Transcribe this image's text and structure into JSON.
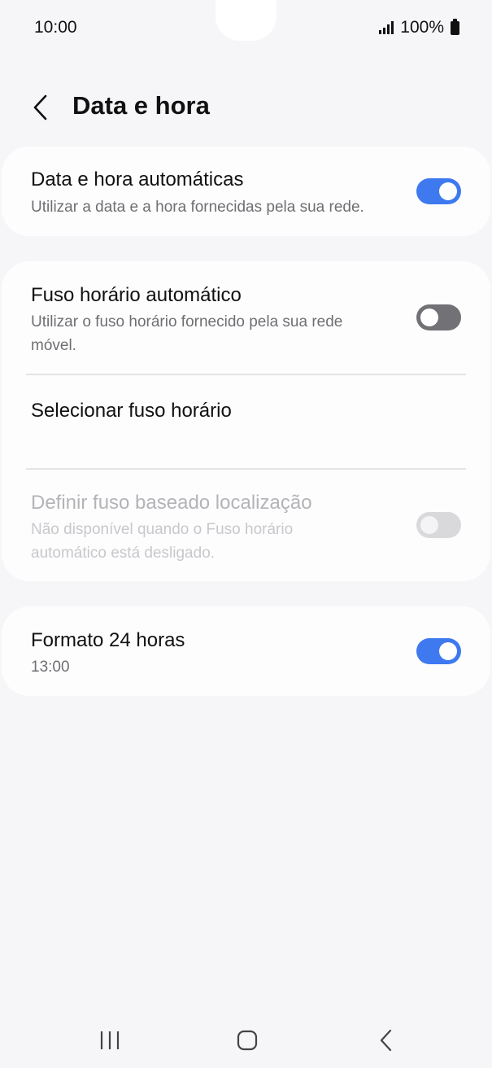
{
  "status_bar": {
    "time": "10:00",
    "battery_text": "100%",
    "icons": [
      "signal-icon",
      "battery-icon"
    ]
  },
  "header": {
    "back_icon": "chevron-left-icon",
    "title": "Data e hora"
  },
  "settings": {
    "auto_datetime": {
      "title": "Data e hora automáticas",
      "subtitle": "Utilizar a data e a hora fornecidas pela sua rede.",
      "enabled": true
    },
    "auto_timezone": {
      "title": "Fuso horário automático",
      "subtitle": "Utilizar o fuso horário fornecido pela sua rede móvel.",
      "enabled": false
    },
    "select_timezone": {
      "title": "Selecionar fuso horário"
    },
    "location_timezone": {
      "title": "Definir fuso baseado localização",
      "subtitle": "Não disponível quando o Fuso horário automático está desligado.",
      "enabled": false,
      "disabled": true
    },
    "format_24h": {
      "title": "Formato 24 horas",
      "subtitle": "13:00",
      "enabled": true
    }
  },
  "nav_bar": {
    "icons": [
      "recent-apps-icon",
      "home-icon",
      "back-icon"
    ]
  },
  "colors": {
    "accent": "#3e79f0",
    "background": "#f6f6f8",
    "card": "#fdfdfe"
  }
}
